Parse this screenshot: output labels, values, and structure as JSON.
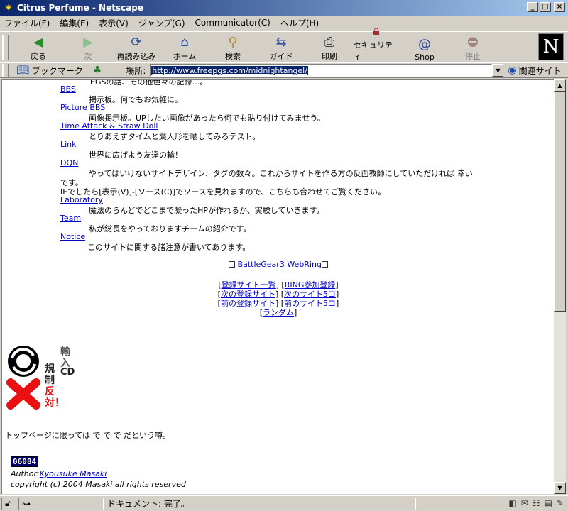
{
  "window": {
    "title": "Citrus Perfume - Netscape",
    "buttons": {
      "minimize": "_",
      "maximize": "□",
      "close": "×"
    }
  },
  "menu": [
    "ファイル(F)",
    "編集(E)",
    "表示(V)",
    "ジャンプ(G)",
    "Communicator(C)",
    "ヘルプ(H)"
  ],
  "toolbar": {
    "back": "戻る",
    "forward": "次",
    "reload": "再読み込み",
    "home": "ホーム",
    "search": "検索",
    "guide": "ガイド",
    "print": "印刷",
    "security": "セキュリティ",
    "shop": "Shop",
    "stop": "停止",
    "logo": "N"
  },
  "location": {
    "bookmarks_label": "ブックマーク",
    "location_label": "場所:",
    "url": "http://www.freepgs.com/midnightangel/",
    "related_label": "関連サイト"
  },
  "page": {
    "top_partial": "EGSの話、その他色々の記録…。",
    "items": [
      {
        "link": "BBS",
        "desc": "掲示板。何でもお気軽に。"
      },
      {
        "link": "Picture BBS",
        "desc": "画像掲示板。UPしたい画像があったら何でも貼り付けてみませう。"
      },
      {
        "link": "Time Attack & Straw Doll",
        "desc": "とりあえずタイムと藁人形を晒してみるテスト。"
      },
      {
        "link": "Link",
        "desc": "世界に広げよう友達の輪！"
      },
      {
        "link": "DQN",
        "desc": "やってはいけないサイトデザイン、タグの数々。これからサイトを作る方の反面教師にしていただければ 幸い"
      },
      {
        "link": "Laboratory",
        "desc": "魔法のらんどでどこまで凝ったHPが作れるか、実験していきます。"
      },
      {
        "link": "Team",
        "desc": "私が総長をやっておりますチームの紹介です。"
      },
      {
        "link": "Notice",
        "desc": "このサイトに関する諸注意が書いてあります。"
      }
    ],
    "dqn_cont1": "です。",
    "dqn_cont2": "IEでしたら[表示(V)]-[ソース(C)]でソースを見れますので、こちらも合わせてご覧ください。",
    "webring": {
      "name": "BattleGear3 WebRing",
      "links": [
        "登録サイト一覧",
        "RING参加登録",
        "次の登録サイト",
        "次のサイト5コ",
        "前の登録サイト",
        "前のサイト5コ",
        "ランダム"
      ]
    },
    "badge": {
      "l1": "輸",
      "l2": "入",
      "l3": "規",
      "l4": "CD",
      "l5": "制",
      "l6": "反",
      "l7": "対！"
    },
    "rumor": "トップページに限っては で で で だという噂。",
    "counter": "06084",
    "author_label": "Author:",
    "author_name": "Kyousuke Masaki",
    "copyright": "copyright (c) 2004 Masaki all rights reserved"
  },
  "status": {
    "text": "ドキュメント: 完了。"
  },
  "colors": {
    "link": "#0000cc",
    "title_bar": "#0a246a",
    "chrome": "#d4d0c8"
  }
}
